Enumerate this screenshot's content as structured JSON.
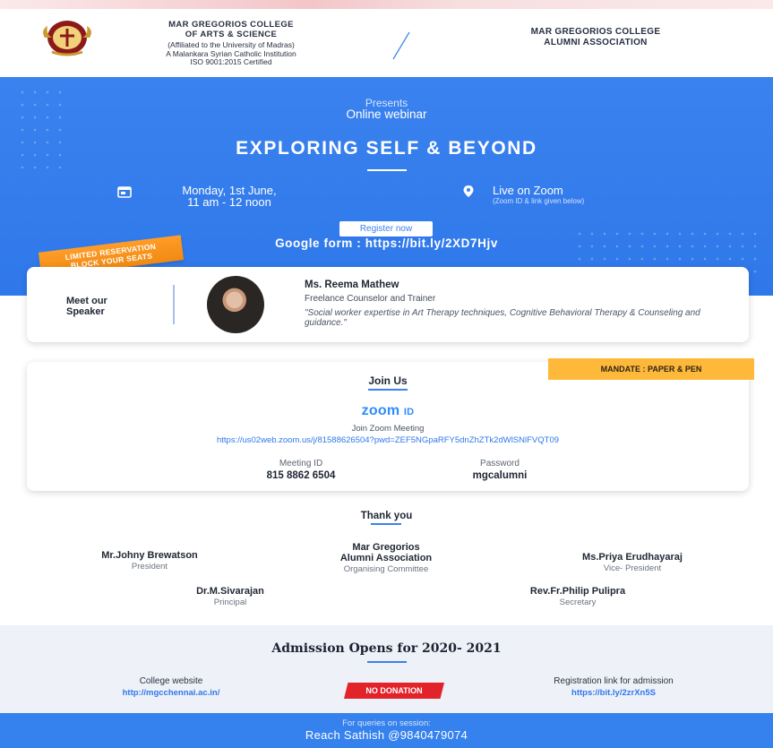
{
  "header": {
    "college_name_line1": "MAR GREGORIOS COLLEGE",
    "college_name_line2": "OF ARTS & SCIENCE",
    "affiliation_line1": "(Affiliated to the University of Madras)",
    "affiliation_line2": "A Malankara Syrian Catholic Institution",
    "affiliation_line3": "ISO 9001:2015 Certified",
    "alumni_line1": "MAR GREGORIOS COLLEGE",
    "alumni_line2": "ALUMNI ASSOCIATION"
  },
  "banner": {
    "presents": "Presents",
    "event_type": "Online webinar",
    "title": "EXPLORING SELF & BEYOND",
    "date_line1": "Monday, 1st June,",
    "date_line2": "11 am - 12 noon",
    "venue": "Live on Zoom",
    "venue_note": "(Zoom ID & link given below)",
    "register_label": "Register now",
    "google_form": "Google form : https://bit.ly/2XD7Hjv",
    "ribbon_line1": "LIMITED RESERVATION",
    "ribbon_line2": "BLOCK YOUR SEATS"
  },
  "speaker": {
    "heading_line1": "Meet our",
    "heading_line2": "Speaker",
    "name": "Ms. Reema Mathew",
    "role": "Freelance Counselor and Trainer",
    "quote": "\"Social worker expertise in Art Therapy techniques, Cognitive Behavioral Therapy & Counseling and guidance.\""
  },
  "join": {
    "badge": "MANDATE : PAPER & PEN",
    "title": "Join Us",
    "zoom_brand": "zoom",
    "zoom_id": "ID",
    "join_meeting": "Join Zoom Meeting",
    "link": "https://us02web.zoom.us/j/81588626504?pwd=ZEF5NGpaRFY5dnZhZTk2dWlSNlFVQT09",
    "meeting_id_label": "Meeting ID",
    "meeting_id": "815 8862 6504",
    "password_label": "Password",
    "password": "mgcalumni"
  },
  "thanks": {
    "title": "Thank you",
    "people": [
      {
        "name": "Mr.Johny Brewatson",
        "role": "President"
      },
      {
        "name": "Mar Gregorios Alumni Association",
        "name_line1": "Mar Gregorios",
        "name_line2": "Alumni Association",
        "role": "Organising Committee"
      },
      {
        "name": "Ms.Priya Erudhayaraj",
        "role": "Vice- President"
      },
      {
        "name": "Dr.M.Sivarajan",
        "role": "Principal"
      },
      {
        "name": "Rev.Fr.Philip Pulipra",
        "role": "Secretary"
      }
    ]
  },
  "admission": {
    "title": "Admission Opens for 2020- 2021",
    "website_label": "College website",
    "website_link": "http://mgcchennai.ac.in/",
    "no_donation": "NO DONATION",
    "registration_label": "Registration link for admission",
    "registration_link": "https://bit.ly/2zrXn5S"
  },
  "footer": {
    "query_label": "For queries on session:",
    "contact": "Reach Sathish @9840479074"
  },
  "colors": {
    "primary_blue": "#3a82ee",
    "ribbon_orange": "#f5931c",
    "badge_yellow": "#ffb93a",
    "no_donation_red": "#e3232a",
    "zoom_blue": "#2d8cff"
  },
  "icons": [
    "college-logo-icon",
    "calendar-icon",
    "location-pin-icon"
  ]
}
